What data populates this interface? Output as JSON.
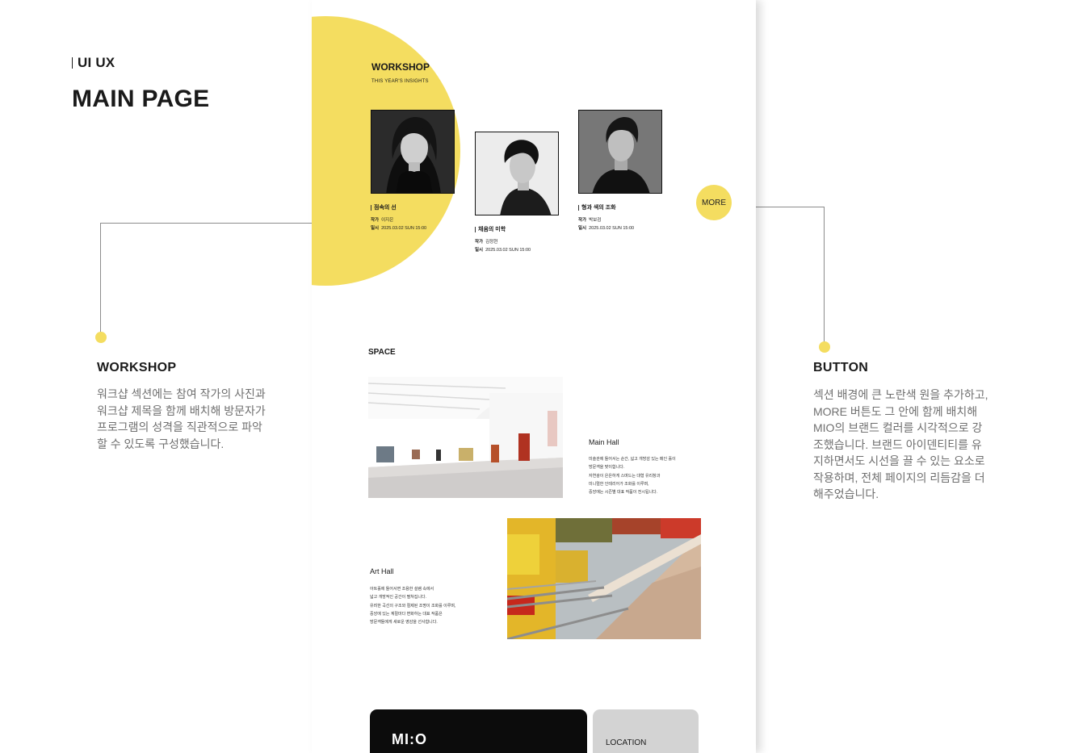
{
  "header": {
    "kicker": "UI UX",
    "title": "MAIN PAGE"
  },
  "workshop_section": {
    "title": "WORKSHOP",
    "subtitle": "THIS YEAR'S INSIGHTS",
    "more_label": "MORE",
    "artists": [
      {
        "title": "점속의 선",
        "artist_label": "작가",
        "artist": "이지은",
        "date_label": "일시",
        "date": "2025.03.02 SUN 15:00"
      },
      {
        "title": "채움의 미학",
        "artist_label": "작가",
        "artist": "김정현",
        "date_label": "일시",
        "date": "2025.03.02 SUN 15:00"
      },
      {
        "title": "형과 색의 조화",
        "artist_label": "작가",
        "artist": "박보검",
        "date_label": "일시",
        "date": "2025.03.02 SUN 15:00"
      }
    ]
  },
  "space_section": {
    "title": "SPACE",
    "main_hall": {
      "name": "Main Hall",
      "desc": [
        "미술관에 들어서는 순간, 넓고 개방감 있는 메인 홀이",
        "방문객을 맞이합니다.",
        "자연광이 은은하게 스며드는 대형 유리창과",
        "미니멀한 인테리어가 조화를 이루며,",
        "중앙에는 시즌별 대표 작품이 전시됩니다."
      ]
    },
    "art_hall": {
      "name": "Art Hall",
      "desc": [
        "아트홀에 들어서면 조용한 설렘 속에서",
        "넓고 개방적인 공간이 펼쳐집니다.",
        "유려한 곡선의 구조와 절제된 조명이 조화를 이루며,",
        "중앙에 있는 계절마다 변화하는 대표 작품은",
        "방문객들에게 새로운 영감을 선사합니다."
      ]
    }
  },
  "footer_cards": {
    "logo": "MI:O",
    "location": "LOCATION"
  },
  "notes": {
    "workshop": {
      "title": "WORKSHOP",
      "lines": [
        "워크샵 섹션에는 참여 작가의 사진과",
        "워크샵 제목을 함께 배치해 방문자가",
        "프로그램의 성격을 직관적으로 파악",
        "할 수 있도록 구성했습니다."
      ]
    },
    "button": {
      "title": "BUTTON",
      "lines": [
        "섹션 배경에 큰 노란색 원을 추가하고,",
        "MORE 버튼도 그 안에 함께 배치해",
        "MIO의 브랜드 컬러를 시각적으로 강",
        "조했습니다. 브랜드 아이덴티티를 유",
        "지하면서도 시선을 끌 수 있는 요소로",
        "작용하며, 전체 페이지의 리듬감을 더",
        "해주었습니다."
      ]
    }
  },
  "colors": {
    "accent_yellow": "#f4dd60",
    "dark": "#0c0c0c",
    "muted_text": "#6f6f6f",
    "card_gray": "#d3d3d3"
  }
}
